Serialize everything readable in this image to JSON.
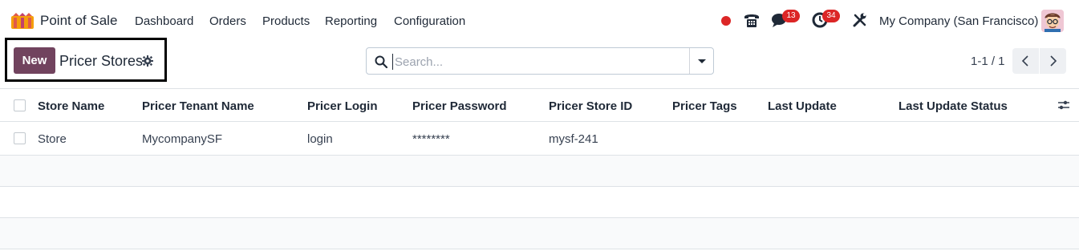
{
  "app": {
    "name": "Point of Sale"
  },
  "nav": {
    "items": [
      "Dashboard",
      "Orders",
      "Products",
      "Reporting",
      "Configuration"
    ]
  },
  "systray": {
    "messages_count": "13",
    "activities_count": "34",
    "company": "My Company (San Francisco)"
  },
  "control": {
    "new_label": "New",
    "title": "Pricer Stores",
    "search_placeholder": "Search...",
    "pager": "1-1 / 1"
  },
  "table": {
    "columns": [
      "Store Name",
      "Pricer Tenant Name",
      "Pricer Login",
      "Pricer Password",
      "Pricer Store ID",
      "Pricer Tags",
      "Last Update",
      "Last Update Status"
    ],
    "rows": [
      [
        "Store",
        "MycompanySF",
        "login",
        "********",
        "mysf-241",
        "",
        "",
        ""
      ]
    ]
  },
  "colors": {
    "brand": "#71435e",
    "badge": "#dc2626"
  },
  "icons": [
    "pos-logo-icon",
    "record-dot-icon",
    "phone-icon",
    "chat-icon",
    "clock-icon",
    "tools-icon",
    "gear-icon",
    "search-icon",
    "caret-down-icon",
    "chevron-left-icon",
    "chevron-right-icon",
    "column-settings-icon"
  ]
}
